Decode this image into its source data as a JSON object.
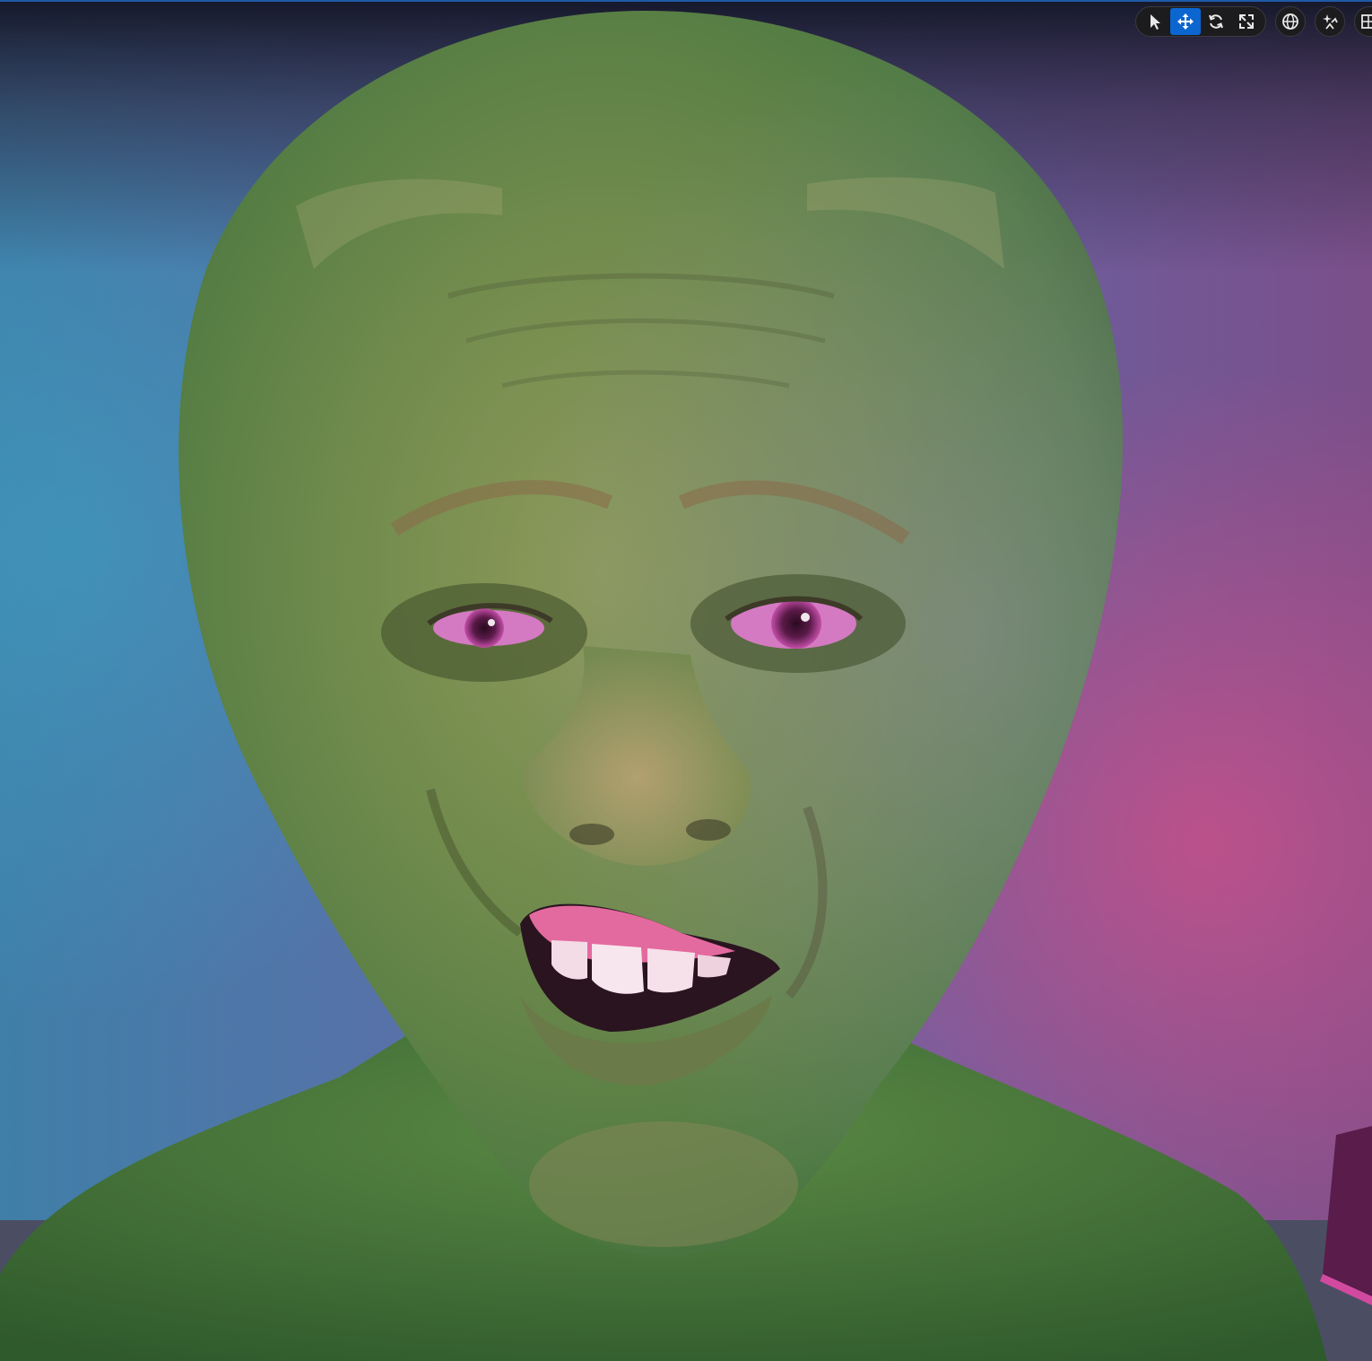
{
  "viewport": {
    "scene": "sculpted-character-head",
    "accent_color": "#0b66d0",
    "toolbar_bg": "#1c1c1f"
  },
  "toolbar": {
    "transform_tools": [
      {
        "id": "select",
        "icon": "cursor-arrow-icon",
        "active": false
      },
      {
        "id": "translate",
        "icon": "move-arrows-icon",
        "active": true
      },
      {
        "id": "rotate",
        "icon": "rotate-icon",
        "active": false
      },
      {
        "id": "scale",
        "icon": "scale-icon",
        "active": false
      }
    ],
    "extra_tools": [
      {
        "id": "world-space",
        "icon": "globe-icon"
      },
      {
        "id": "surface-snap",
        "icon": "snap-sparkle-icon"
      },
      {
        "id": "grid-snap",
        "icon": "grid-icon"
      }
    ]
  }
}
